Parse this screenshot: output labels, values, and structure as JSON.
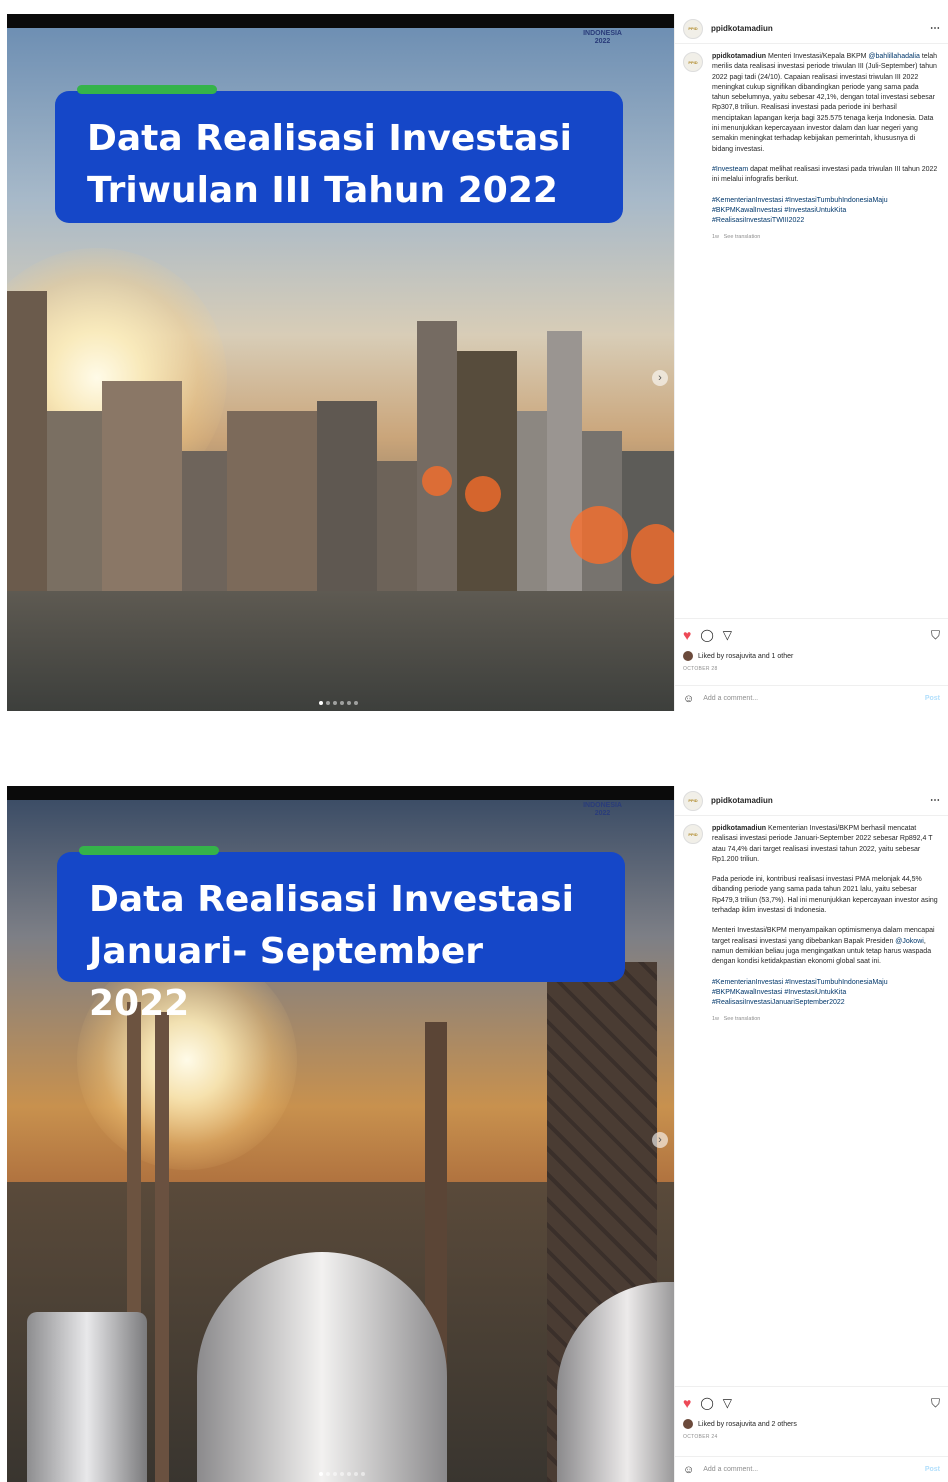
{
  "posts": [
    {
      "brand_lines": [
        "INDONESIA",
        "2022"
      ],
      "banner_title_line1": "Data Realisasi Investasi",
      "banner_title_line2": "Triwulan III Tahun 2022",
      "username": "ppidkotamadiun",
      "caption_user": "ppidkotamadiun",
      "caption_part1": "Menteri Investasi/Kepala BKPM",
      "caption_mention": "@bahlillahadalia",
      "caption_part2": "telah merilis data realisasi investasi periode triwulan III (Juli-September) tahun 2022 pagi tadi (24/10). Capaian realisasi investasi triwulan III 2022 meningkat cukup signifikan dibandingkan periode yang sama pada tahun sebelumnya, yaitu sebesar 42,1%, dengan total investasi sebesar Rp307,8 triliun. Realisasi investasi pada periode ini berhasil menciptakan lapangan kerja bagi 325.575 tenaga kerja Indonesia. Data ini menunjukkan kepercayaan investor dalam dan luar negeri yang semakin meningkat terhadap kebijakan pemerintah, khususnya di bidang investasi.",
      "caption_p2_tag": "#Investeam",
      "caption_p2_text": "dapat melihat realisasi investasi pada triwulan III tahun 2022 ini melalui infografis berikut.",
      "hashtags": "#KementerianInvestasi #InvestasiTumbuhIndonesiaMaju #BKPMKawalInvestasi #InvestasiUntukKita #RealisasiInvestasiTWIII2022",
      "time_ago": "1w",
      "see_translation": "See translation",
      "liked_by": "Liked by rosajuvita and 1 other",
      "date": "OCTOBER 28",
      "comment_placeholder": "Add a comment...",
      "post_label": "Post"
    },
    {
      "brand_lines": [
        "INDONESIA",
        "2022"
      ],
      "banner_title_line1": "Data Realisasi Investasi",
      "banner_title_line2": "Januari- September 2022",
      "username": "ppidkotamadiun",
      "caption_user": "ppidkotamadiun",
      "caption_part1": "Kementerian Investasi/BKPM berhasil mencatat realisasi investasi periode Januari-September 2022 sebesar Rp892,4 T atau 74,4% dari target realisasi investasi tahun 2022, yaitu sebesar Rp1.200 triliun.",
      "caption_p2": "Pada periode ini, kontribusi realisasi investasi PMA melonjak 44,5% dibanding periode yang sama pada tahun 2021 lalu, yaitu sebesar Rp479,3 triliun (53,7%). Hal ini menunjukkan kepercayaan investor asing terhadap iklim investasi di Indonesia.",
      "caption_p3_part1": "Menteri Investasi/BKPM menyampaikan optimismenya dalam mencapai target realisasi investasi yang dibebankan Bapak Presiden",
      "caption_p3_mention": "@Jokowi",
      "caption_p3_part2": ", namun demikian beliau juga mengingatkan untuk tetap harus waspada dengan kondisi ketidakpastian ekonomi global saat ini.",
      "hashtags": "#KementerianInvestasi #InvestasiTumbuhIndonesiaMaju #BKPMKawalInvestasi #InvestasiUntukKita #RealisasiInvestasiJanuariSeptember2022",
      "time_ago": "1w",
      "see_translation": "See translation",
      "liked_by": "Liked by rosajuvita and 2 others",
      "date": "OCTOBER 24",
      "comment_placeholder": "Add a comment...",
      "post_label": "Post"
    }
  ],
  "icons": {
    "heart": "heart-icon",
    "comment": "comment-icon",
    "share": "share-icon",
    "bookmark": "bookmark-icon",
    "more": "more-icon",
    "emoji": "emoji-icon",
    "next": "next-arrow-icon"
  },
  "colors": {
    "banner_blue": "#1547c8",
    "banner_accent_green": "#35b34a",
    "like_red": "#ed4956",
    "link_blue": "#00376b"
  },
  "carousel": {
    "post1_slides": 6,
    "post1_active": 1,
    "post2_slides": 7,
    "post2_active": 1
  }
}
